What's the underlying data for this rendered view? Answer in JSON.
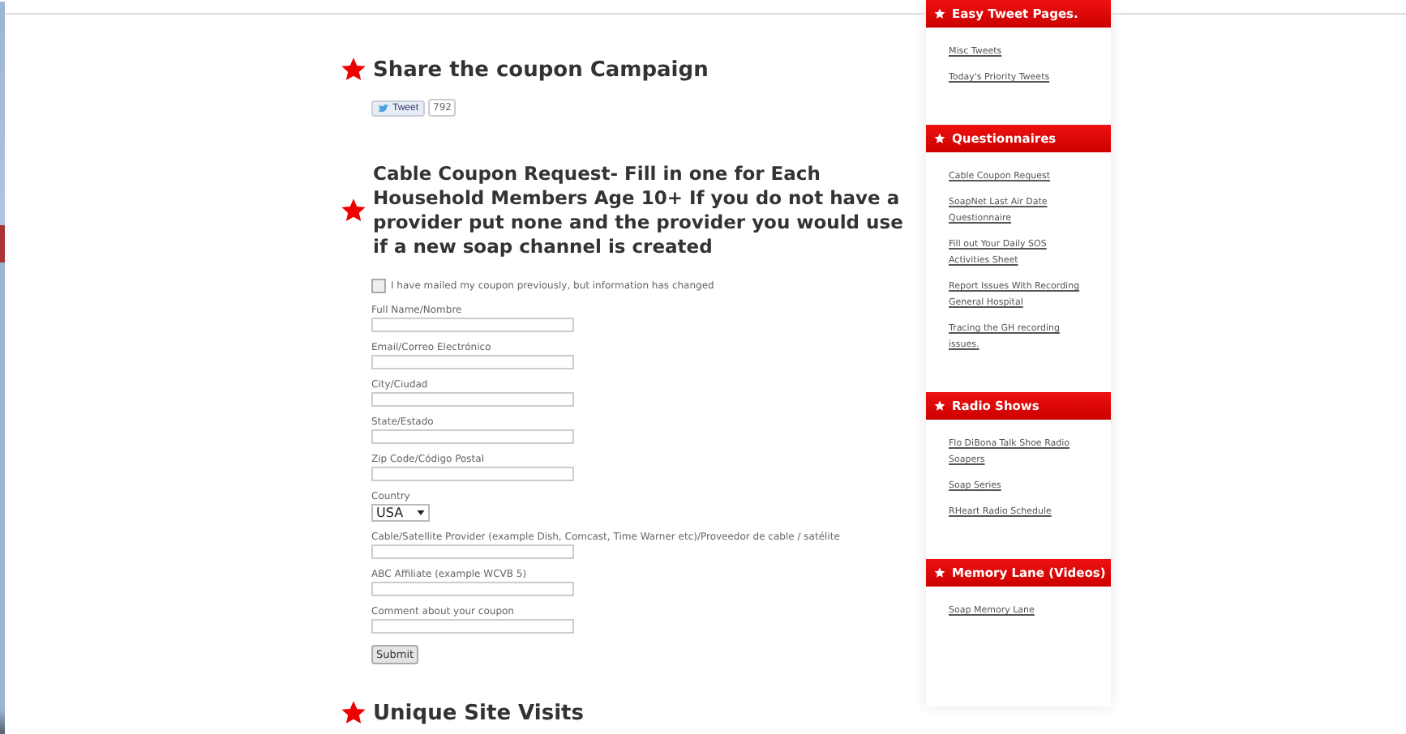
{
  "share": {
    "title": "Share the coupon Campaign",
    "tweet_button": "Tweet",
    "tweet_count": "792"
  },
  "form": {
    "title": "Cable Coupon Request- Fill in one for Each Household Members Age 10+ If you do not have a provider put none and the provider you would use if a new soap channel is created",
    "checkbox": {
      "label": "I have mailed my coupon previously, but information has changed",
      "checked": false
    },
    "fields": [
      {
        "kind": "text",
        "label": "Full Name/Nombre"
      },
      {
        "kind": "text",
        "label": "Email/Correo Electrónico"
      },
      {
        "kind": "text",
        "label": "City/Ciudad"
      },
      {
        "kind": "text",
        "label": "State/Estado"
      },
      {
        "kind": "text",
        "label": "Zip Code/Código Postal"
      },
      {
        "kind": "select",
        "label": "Country",
        "value": "USA"
      },
      {
        "kind": "text",
        "label": "Cable/Satellite Provider (example Dish, Comcast, Time Warner etc)/Proveedor de cable / satélite"
      },
      {
        "kind": "text",
        "label": "ABC Affiliate (example WCVB 5)"
      },
      {
        "kind": "text",
        "label": "Comment about your coupon"
      }
    ],
    "submit": "Submit"
  },
  "visits": {
    "title": "Unique Site Visits"
  },
  "sidebar": [
    {
      "title": "Easy Tweet Pages.",
      "links": [
        "Misc Tweets",
        "Today's Priority Tweets"
      ]
    },
    {
      "title": "Questionnaires",
      "links": [
        "Cable Coupon Request",
        "SoapNet Last Air Date Questionnaire",
        "Fill out Your Daily SOS Activities Sheet",
        "Report Issues With Recording General Hospital",
        "Tracing the GH recording issues."
      ]
    },
    {
      "title": "Radio Shows",
      "links": [
        "Flo DiBona Talk Shoe Radio Soapers",
        "Soap Series",
        "RHeart Radio Schedule"
      ]
    },
    {
      "title": "Memory Lane (Videos)",
      "links": [
        "Soap Memory Lane"
      ]
    }
  ]
}
